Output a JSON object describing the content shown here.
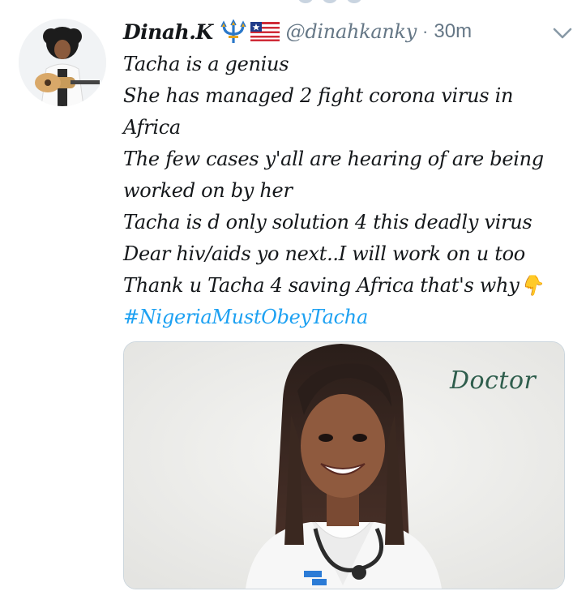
{
  "tweet": {
    "display_name": "Dinah.K",
    "badges": [
      "trident-emoji",
      "liberia-flag-emoji"
    ],
    "handle": "@dinahkanky",
    "separator": "·",
    "timestamp": "30m",
    "lines": [
      "Tacha is a genius",
      "She has managed 2 fight corona virus in",
      "Africa",
      "The few cases y'all are hearing of are being",
      "worked on by her",
      "Tacha is d only solution 4 this deadly virus",
      "Dear hiv/aids yo next..I will work on u too",
      "Thank u Tacha 4 saving Africa that's why"
    ],
    "emoji_after_last_line": "👇",
    "hashtag": "#NigeriaMustObeyTacha"
  },
  "media": {
    "caption": "Doctor"
  },
  "colors": {
    "text": "#14171a",
    "secondary": "#657786",
    "link": "#1da1f2",
    "border": "#ccd6dd"
  }
}
